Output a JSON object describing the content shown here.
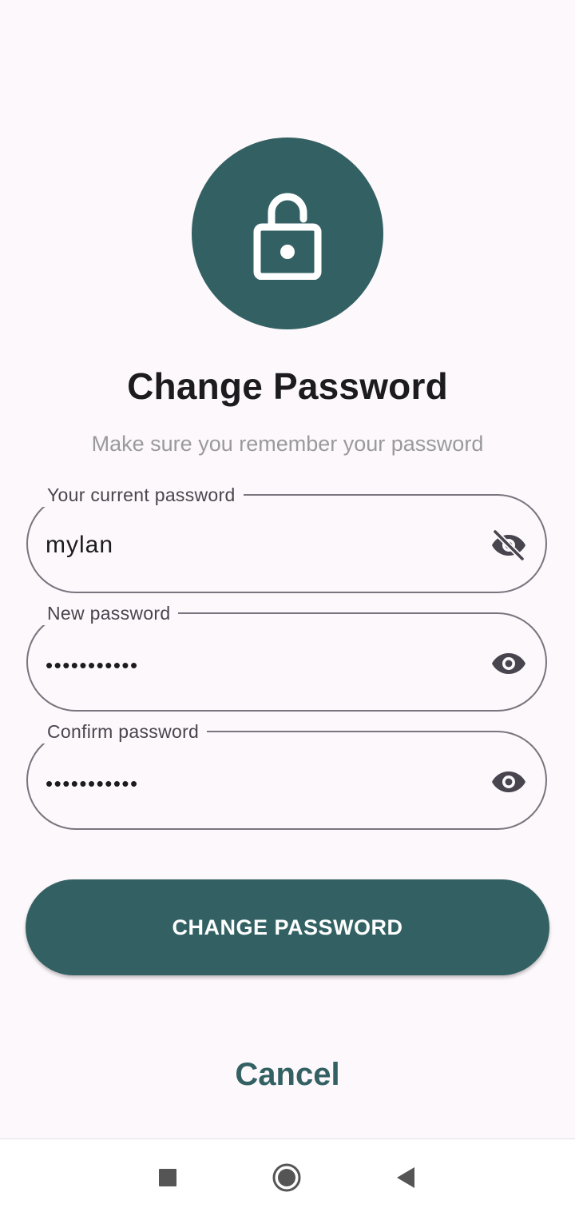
{
  "header": {
    "title": "Change Password",
    "subtitle": "Make sure you remember your password"
  },
  "fields": [
    {
      "label": "Your current password",
      "value": "mylan",
      "visibility_icon": "eye-off-icon"
    },
    {
      "label": "New password",
      "value": "•••••••••••",
      "visibility_icon": "eye-icon"
    },
    {
      "label": "Confirm password",
      "value": "•••••••••••",
      "visibility_icon": "eye-icon"
    }
  ],
  "actions": {
    "primary_label": "CHANGE PASSWORD",
    "cancel_label": "Cancel"
  },
  "nav": {
    "recents_icon": "square-icon",
    "home_icon": "circle-icon",
    "back_icon": "triangle-back-icon"
  },
  "colors": {
    "accent": "#336163",
    "background": "#fdf8fb",
    "outline": "#79747e"
  }
}
